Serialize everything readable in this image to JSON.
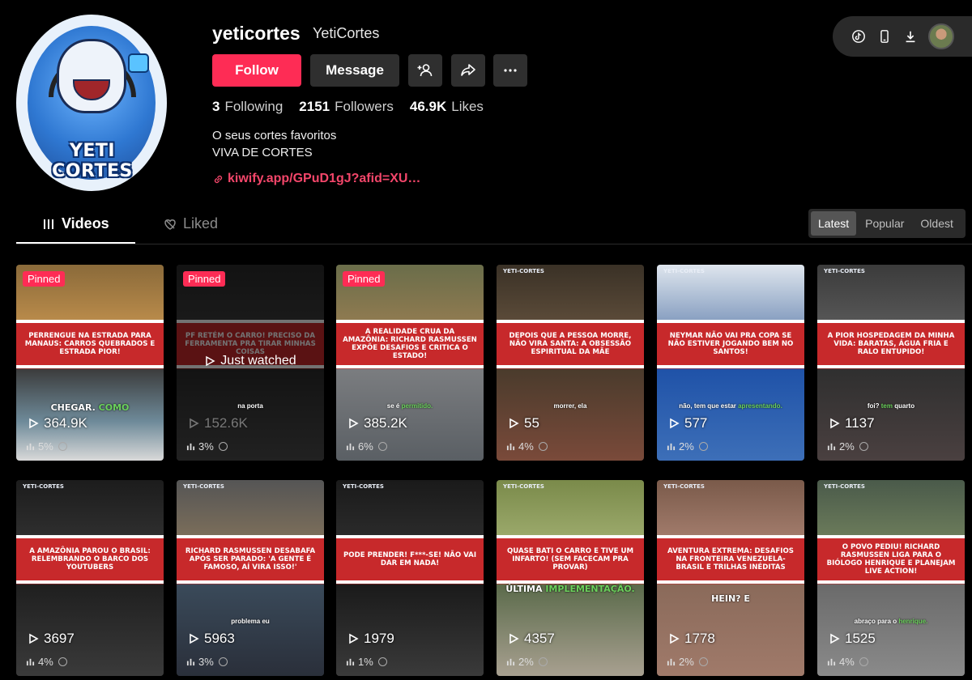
{
  "profile": {
    "username": "yeticortes",
    "nickname": "YetiCortes",
    "avatar_logo_text": "YETI CORTES",
    "follow_label": "Follow",
    "message_label": "Message",
    "following_count": "3",
    "following_label": "Following",
    "followers_count": "2151",
    "followers_label": "Followers",
    "likes_count": "46.9K",
    "likes_label": "Likes",
    "bio_line1": "O seus cortes favoritos",
    "bio_line2": "VIVA DE CORTES",
    "link": "kiwify.app/GPuD1gJ?afid=XU…"
  },
  "toolbar": {
    "icons": [
      "tiktok-icon",
      "phone-icon",
      "download-icon"
    ]
  },
  "tabs": {
    "videos": "Videos",
    "liked": "Liked"
  },
  "sort": {
    "options": [
      "Latest",
      "Popular",
      "Oldest"
    ],
    "selected": "Latest"
  },
  "videos": [
    {
      "title": "PERRENGUE NA ESTRADA PARA MANAUS: CARROS QUEBRADOS E ESTRADA PIOR!",
      "views": "364.9K",
      "pct": "5%",
      "pinned": "Pinned",
      "caption": "CHEGAR.",
      "caption_hl": "COMO"
    },
    {
      "title": "PF RETÉM O CARRO! PRECISO DA FERRAMENTA PRA TIRAR MINHAS COISAS",
      "views": "152.6K",
      "pct": "3%",
      "pinned": "Pinned",
      "just_watched": "Just watched",
      "caption": "na porta"
    },
    {
      "title": "A REALIDADE CRUA DA AMAZÔNIA: RICHARD RASMUSSEN EXPÕE DESAFIOS E CRITICA O ESTADO!",
      "views": "385.2K",
      "pct": "6%",
      "pinned": "Pinned",
      "caption": "se é",
      "caption_hl": "permitido."
    },
    {
      "title": "DEPOIS QUE A PESSOA MORRE, NÃO VIRA SANTA: A OBSESSÃO ESPIRITUAL DA MÃE",
      "views": "55",
      "pct": "4%",
      "caption": "morrer, ela"
    },
    {
      "title": "NEYMAR NÃO VAI PRA COPA SE NÃO ESTIVER JOGANDO BEM NO SANTOS!",
      "views": "577",
      "pct": "2%",
      "caption": "não, tem que estar",
      "caption_hl": "apresentando."
    },
    {
      "title": "A PIOR HOSPEDAGEM DA MINHA VIDA: BARATAS, ÁGUA FRIA E RALO ENTUPIDO!",
      "views": "1137",
      "pct": "2%",
      "caption": "foi?",
      "caption_hl": "tem",
      "caption2": "quarto"
    },
    {
      "title": "A AMAZÔNIA PAROU O BRASIL: RELEMBRANDO O BARCO DOS YOUTUBERS",
      "views": "3697",
      "pct": "4%"
    },
    {
      "title": "RICHARD RASMUSSEN DESABAFA APÓS SER PARADO: 'A GENTE É FAMOSO, AÍ VIRA ISSO!'",
      "views": "5963",
      "pct": "3%",
      "caption": "problema",
      "caption2": "eu"
    },
    {
      "title": "PODE PRENDER! F***-SE! NÃO VAI DAR EM NADA!",
      "views": "1979",
      "pct": "1%"
    },
    {
      "title": "QUASE BATI O CARRO E TIVE UM INFARTO! (SEM FACECAM PRA PROVAR)",
      "views": "4357",
      "pct": "2%",
      "caption": "ÚLTIMA",
      "caption_hl": "IMPLEMENTAÇÃO."
    },
    {
      "title": "AVENTURA EXTREMA: DESAFIOS NA FRONTEIRA VENEZUELA-BRASIL E TRILHAS INÉDITAS",
      "views": "1778",
      "pct": "2%",
      "caption": "HEIN?",
      "caption2": "E"
    },
    {
      "title": "O POVO PEDIU! RICHARD RASMUSSEN LIGA PARA O BIÓLOGO HENRIQUE E PLANEJAM LIVE ACTION!",
      "views": "1525",
      "pct": "4%",
      "caption": "abraço para o",
      "caption_hl": "henrique."
    }
  ],
  "brand_tag": "YETI-CORTES",
  "colors": {
    "accent": "#fe2c55",
    "link": "#f3466a",
    "band": "#c7292b"
  }
}
